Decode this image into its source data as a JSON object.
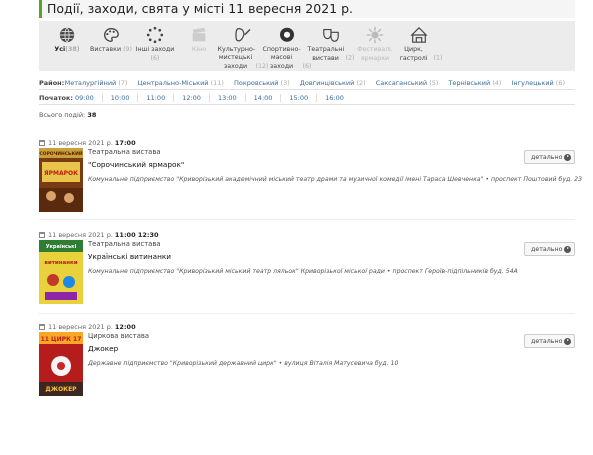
{
  "header": {
    "title": "Події, заходи, свята у місті 11 вересня 2021 р."
  },
  "categories": [
    {
      "label": "Усі",
      "count": "(38)",
      "icon": "globe-icon",
      "active": true,
      "dim": false
    },
    {
      "label": "Виставки",
      "count": "(9)",
      "icon": "palette-icon",
      "active": false,
      "dim": false
    },
    {
      "label": "Інші заходи",
      "count": "(6)",
      "icon": "dots-circle-icon",
      "active": false,
      "dim": false
    },
    {
      "label": "Кіно",
      "count": "",
      "icon": "film-clapper-icon",
      "active": false,
      "dim": true
    },
    {
      "label": "Культурно-мистецькі заходи",
      "count": "(12)",
      "icon": "culture-icon",
      "active": false,
      "dim": false
    },
    {
      "label": "Спортивно-масові заходи",
      "count": "(6)",
      "icon": "sports-icon",
      "active": false,
      "dim": false
    },
    {
      "label": "Театральні вистави",
      "count": "(2)",
      "icon": "theater-masks-icon",
      "active": false,
      "dim": false
    },
    {
      "label": "Фестивалі, ярмарки",
      "count": "",
      "icon": "festival-icon",
      "active": false,
      "dim": true
    },
    {
      "label": "Цирк, гастролі",
      "count": "(1)",
      "icon": "circus-tent-icon",
      "active": false,
      "dim": false
    }
  ],
  "districts": {
    "label": "Район:",
    "items": [
      {
        "name": "Металургійний",
        "count": "(7)"
      },
      {
        "name": "Центрально-Міський",
        "count": "(11)"
      },
      {
        "name": "Покровський",
        "count": "(3)"
      },
      {
        "name": "Довгинцівський",
        "count": "(2)"
      },
      {
        "name": "Саксаганський",
        "count": "(5)"
      },
      {
        "name": "Тернівський",
        "count": "(4)"
      },
      {
        "name": "Інгулецький",
        "count": "(6)"
      }
    ]
  },
  "times": {
    "label": "Початок:",
    "items": [
      "09:00",
      "10:00",
      "11:00",
      "12:00",
      "13:00",
      "14:00",
      "15:00",
      "16:00"
    ]
  },
  "total": {
    "label": "Всього подій:",
    "value": "38"
  },
  "events": [
    {
      "date": "11 вересня 2021 р.",
      "time": "17:00",
      "type": "Театральна вистава",
      "name": "\"Сорочинський ярмарок\"",
      "place": "Комунальне підприємство \"Криворізький академічний міський театр драми та музичної комедії імені Тараса Шевченка\" • проспект Поштовий буд. 23",
      "button": "детально"
    },
    {
      "date": "11 вересня 2021 р.",
      "time": "11:00 12:30",
      "type": "Театральна вистава",
      "name": "Українські витинанки",
      "place": "Комунальне підприємство \"Криворізький міський театр ляльок\" Криворізької міської ради • проспект Героїв-підпільників буд. 54А",
      "button": "детально"
    },
    {
      "date": "11 вересня 2021 р.",
      "time": "12:00",
      "type": "Циркова вистава",
      "name": "Джокер",
      "place": "Державне підприємство \"Криворізький державний цирк\" • вулиця Віталія Матусевича буд. 10",
      "button": "детально"
    }
  ],
  "posters": [
    {
      "text_top": "СОРОЧИНСЬКИЙ",
      "text_bottom": "ЯРМАРОК"
    },
    {
      "text_top": "Українські",
      "text_bottom": "витинанки"
    },
    {
      "text_top": "11 ЦИРК 17",
      "text_bottom": "ДЖОКЕР"
    }
  ]
}
